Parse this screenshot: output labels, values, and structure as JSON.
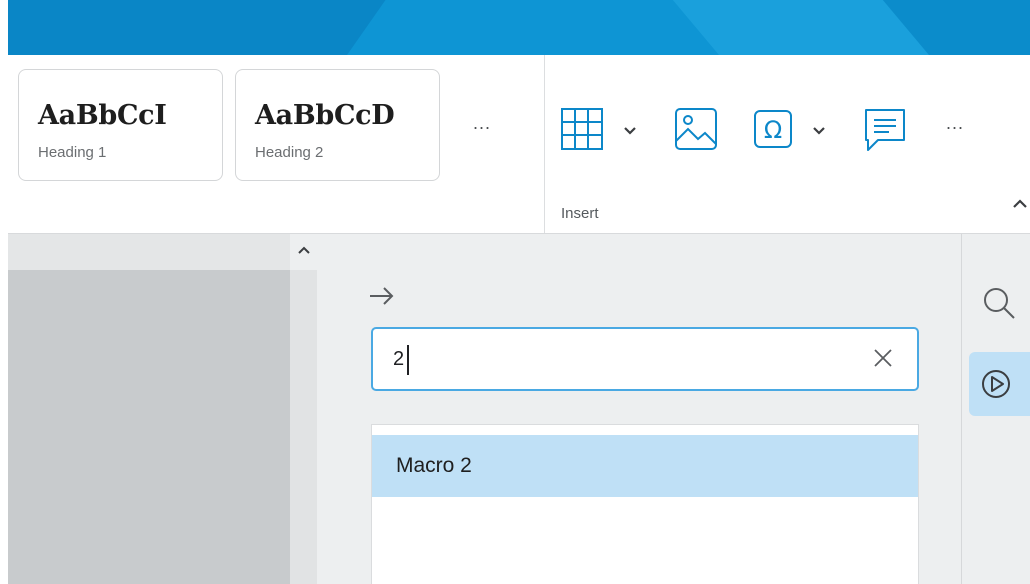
{
  "colors": {
    "titlebar": "#0e95d4",
    "accent": "#4aa9e3",
    "selection": "#bfe0f6"
  },
  "ribbon": {
    "styles": [
      {
        "sample": "AaBbCcI",
        "name": "Heading 1"
      },
      {
        "sample": "AaBbCcD",
        "name": "Heading 2"
      }
    ],
    "styles_more": "...",
    "insert": {
      "group_label": "Insert",
      "icons": [
        "table-icon",
        "image-icon",
        "special-character-icon",
        "comment-icon"
      ],
      "more": "..."
    }
  },
  "panel": {
    "search": {
      "value": "2",
      "clear_icon": "close-icon"
    },
    "results": [
      {
        "label": "Macro 2",
        "selected": true
      }
    ]
  },
  "rail": {
    "icons": [
      "search-icon",
      "macro-play-icon"
    ]
  }
}
